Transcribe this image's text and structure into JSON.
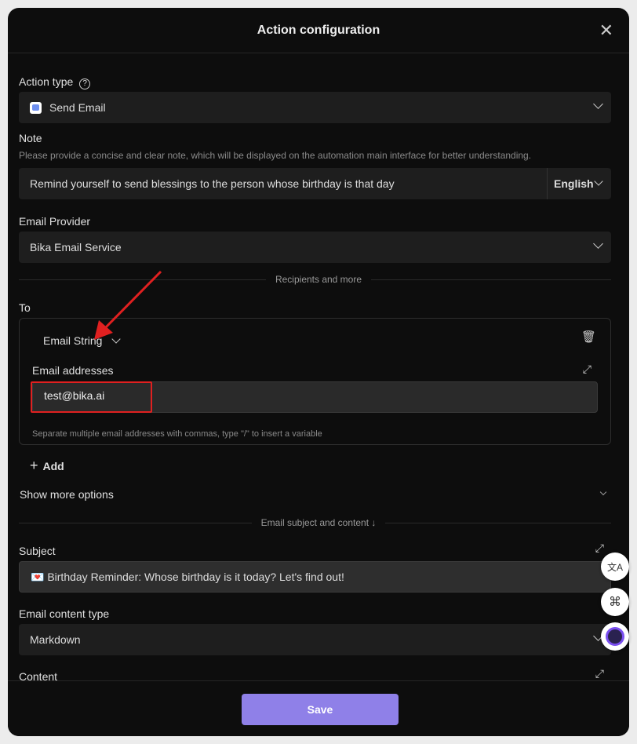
{
  "dialog": {
    "title": "Action configuration"
  },
  "action_type": {
    "label": "Action type",
    "value": "Send Email"
  },
  "note": {
    "label": "Note",
    "hint": "Please provide a concise and clear note, which will be displayed on the automation main interface for better understanding.",
    "value": "Remind yourself to send blessings to the person whose birthday is that day",
    "language": "English"
  },
  "provider": {
    "label": "Email Provider",
    "value": "Bika Email Service"
  },
  "recipients_divider": "Recipients and more",
  "to": {
    "label": "To",
    "type": "Email String",
    "addresses_label": "Email addresses",
    "addresses_value": "test@bika.ai",
    "hint": "Separate multiple email addresses with commas, type \"/\" to insert a variable"
  },
  "add_label": "Add",
  "show_more": "Show more options",
  "content_divider": "Email subject and content ↓",
  "subject": {
    "label": "Subject",
    "value": "💌 Birthday Reminder: Whose birthday is it today? Let's find out!"
  },
  "content_type": {
    "label": "Email content type",
    "value": "Markdown"
  },
  "content": {
    "label": "Content"
  },
  "save_label": "Save",
  "colors": {
    "accent": "#8f80e8",
    "highlight": "#e02020"
  }
}
